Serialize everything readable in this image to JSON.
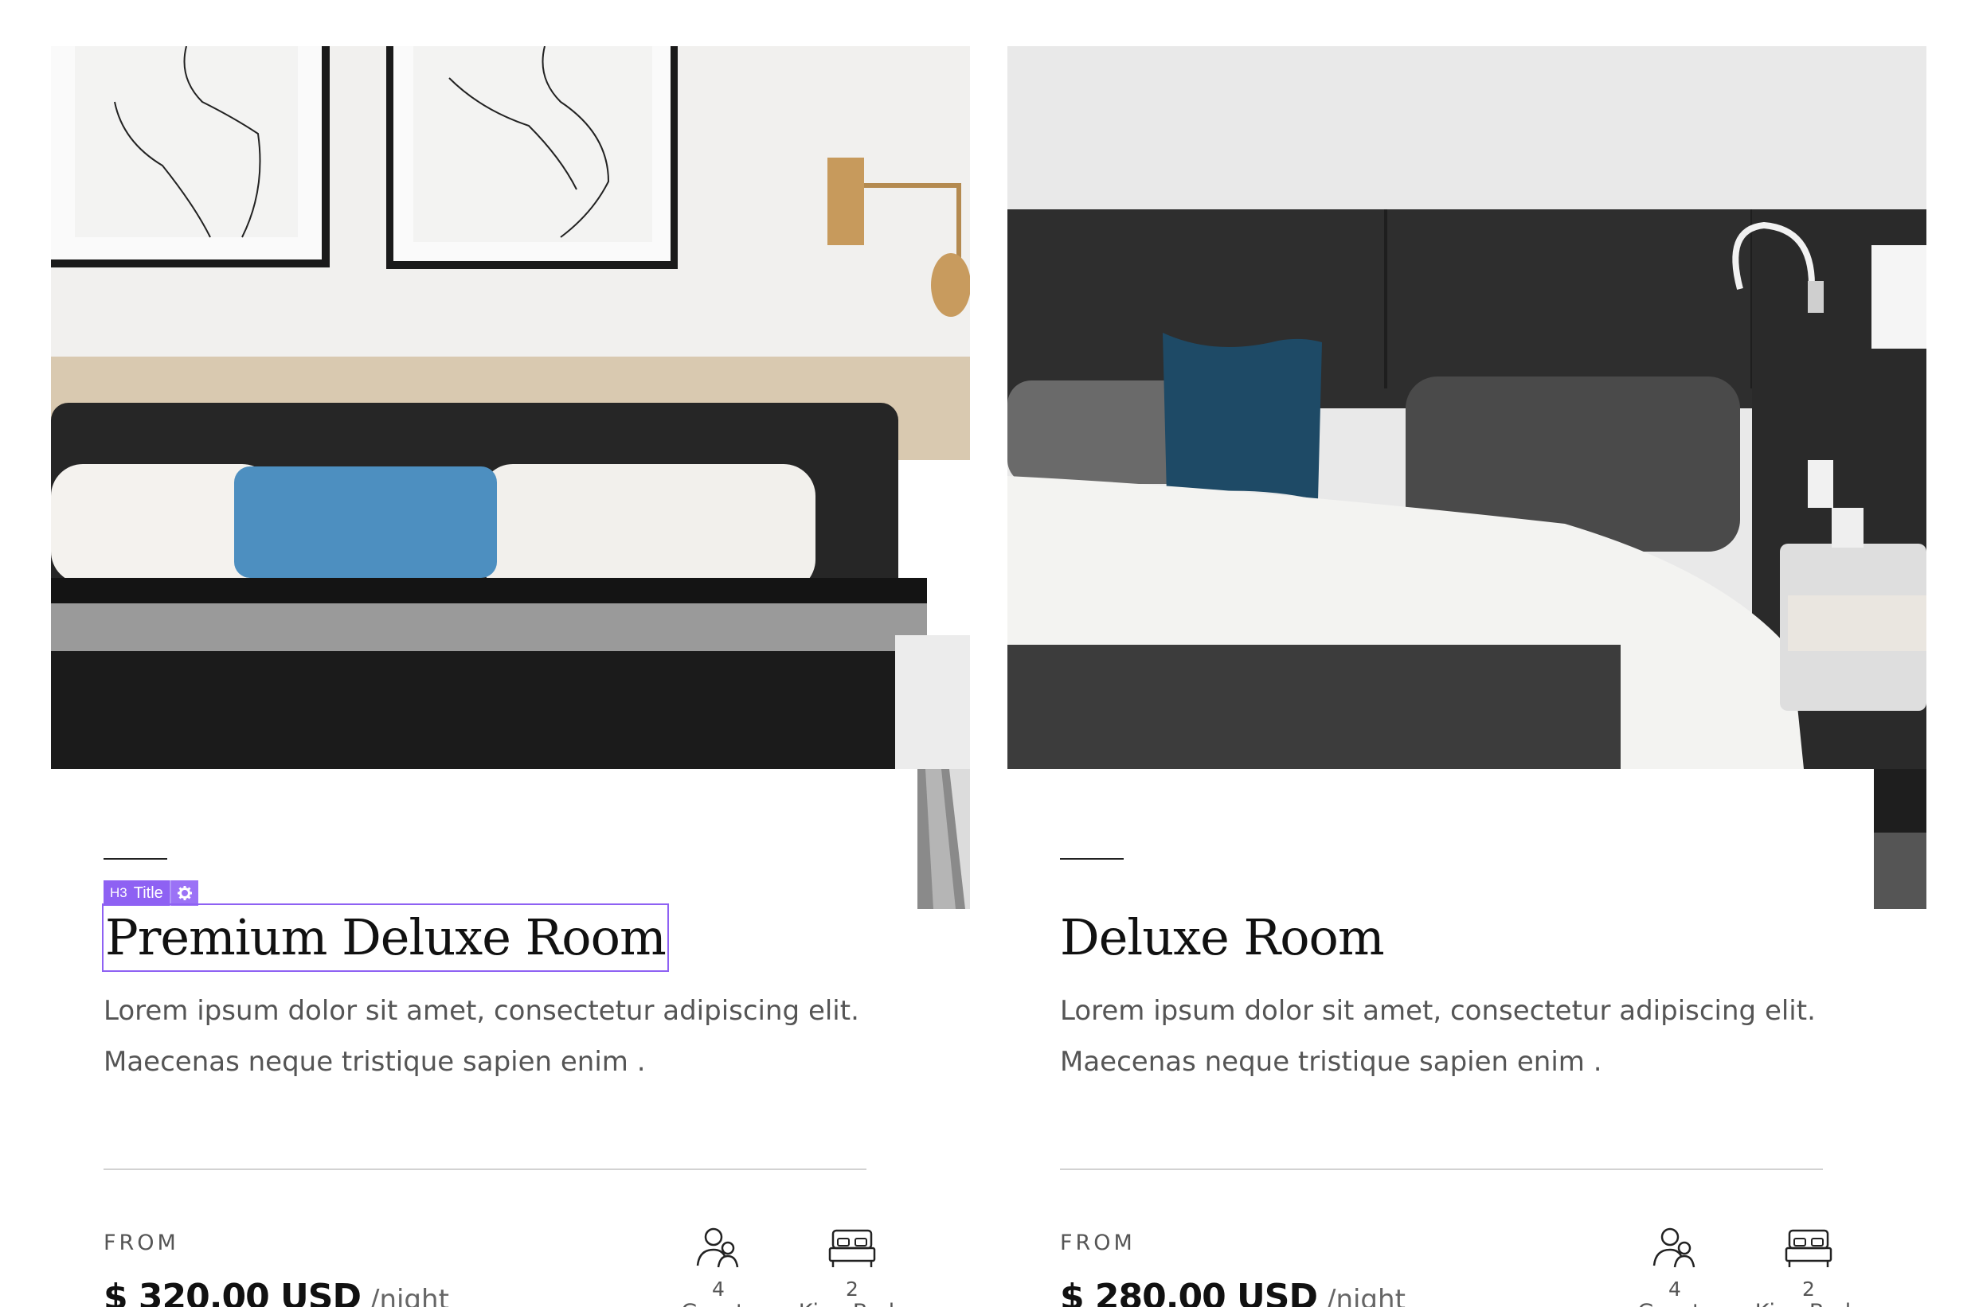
{
  "rooms": [
    {
      "title": "Premium Deluxe Room",
      "description": "Lorem ipsum dolor sit amet, consectetur adipiscing elit. Maecenas neque tristique sapien enim .",
      "from_label": "FROM",
      "price": "$ 320.00 USD",
      "per_night": "/night",
      "guests_count": "4",
      "guests_label": "Guests",
      "beds_count": "2",
      "beds_label": "King Beds",
      "photo_icon": "bedroom-photo"
    },
    {
      "title": "Deluxe Room",
      "description": "Lorem ipsum dolor sit amet, consectetur adipiscing elit. Maecenas neque tristique sapien enim .",
      "from_label": "FROM",
      "price": "$ 280.00 USD",
      "per_night": "/night",
      "guests_count": "4",
      "guests_label": "Guests",
      "beds_count": "2",
      "beds_label": "King Beds",
      "photo_icon": "bedroom-photo"
    }
  ],
  "editor": {
    "tag_heading": "H3",
    "tag_label": "Title",
    "tag_icon": "gear-icon",
    "accent_color": "#8e61f3"
  },
  "icons": {
    "guests": "users-icon",
    "beds": "bed-icon"
  }
}
